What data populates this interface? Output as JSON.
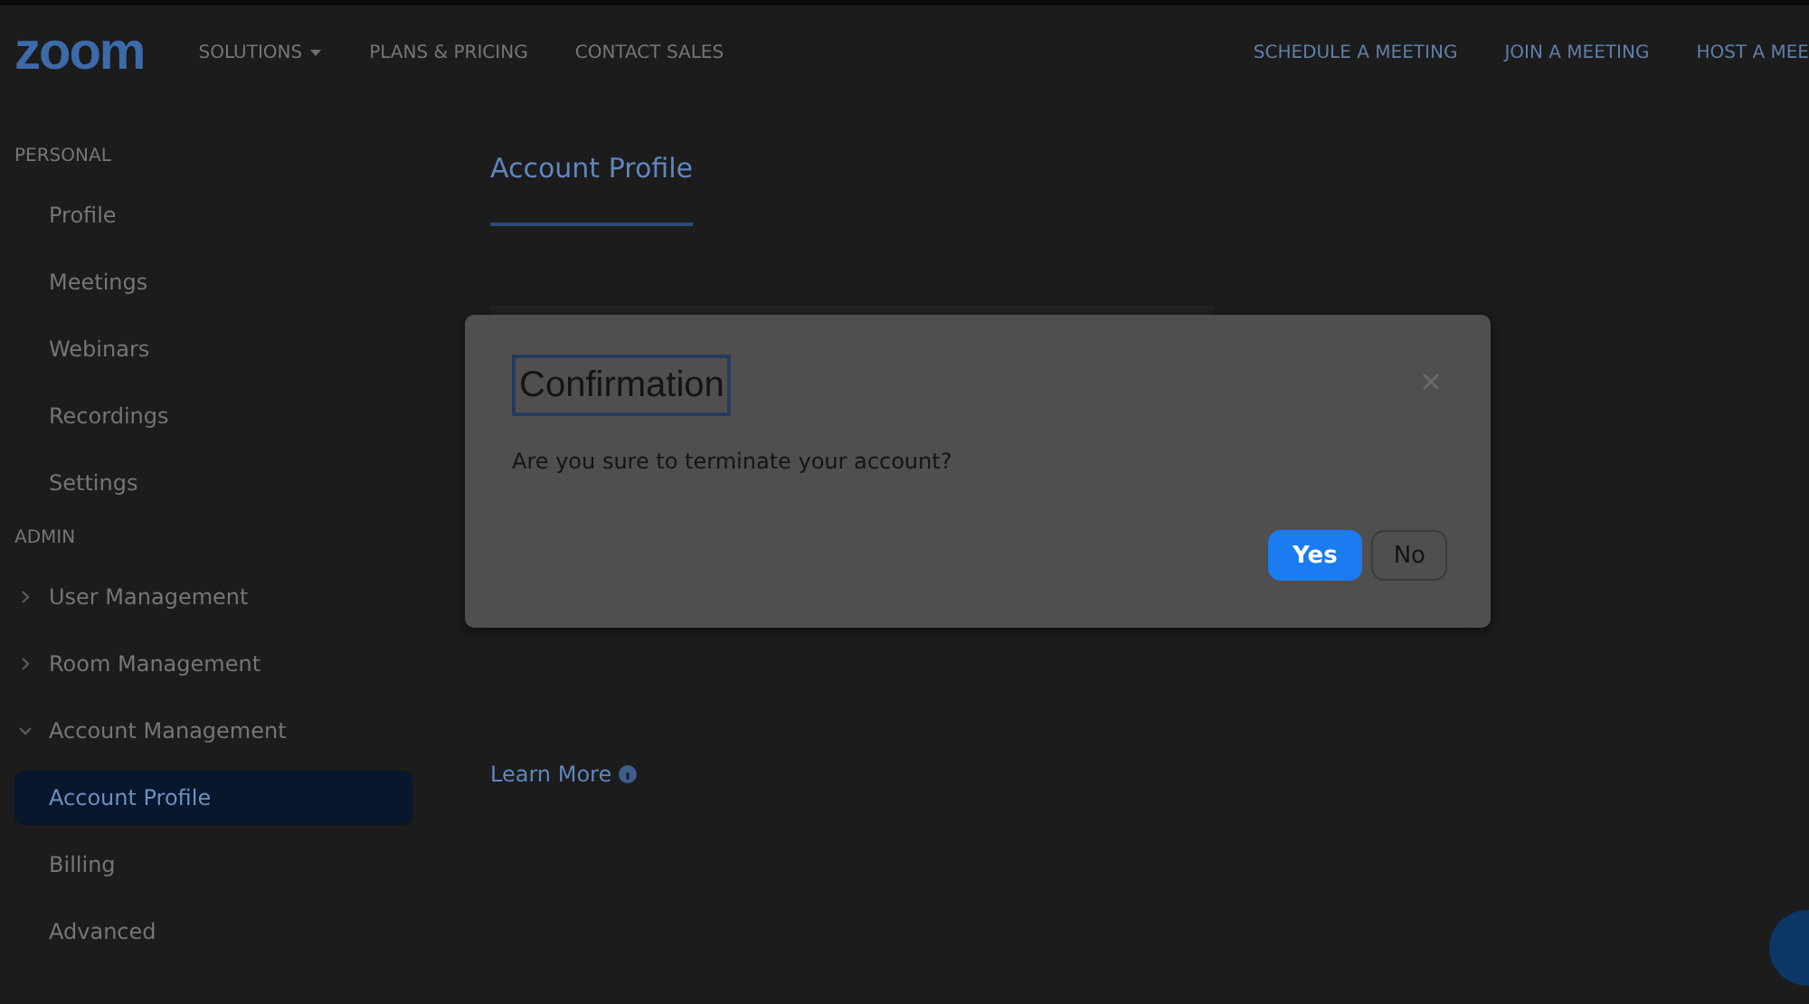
{
  "header": {
    "logo": "zoom",
    "nav_left": [
      {
        "label": "SOLUTIONS",
        "kind": "menu"
      },
      {
        "label": "PLANS & PRICING",
        "kind": "link"
      },
      {
        "label": "CONTACT SALES",
        "kind": "link"
      }
    ],
    "nav_right": [
      {
        "label": "SCHEDULE A MEETING"
      },
      {
        "label": "JOIN A MEETING"
      },
      {
        "label": "HOST A MEE"
      }
    ]
  },
  "sidebar": {
    "sections": [
      {
        "heading": "PERSONAL",
        "items": [
          {
            "label": "Profile",
            "selected": false
          },
          {
            "label": "Meetings",
            "selected": false
          },
          {
            "label": "Webinars",
            "selected": false
          },
          {
            "label": "Recordings",
            "selected": false
          },
          {
            "label": "Settings",
            "selected": false
          }
        ]
      },
      {
        "heading": "ADMIN",
        "items": [
          {
            "label": "User Management",
            "selected": false,
            "expanded": false
          },
          {
            "label": "Room Management",
            "selected": false,
            "expanded": false
          },
          {
            "label": "Account Management",
            "selected": false,
            "expanded": true,
            "children": [
              {
                "label": "Account Profile",
                "selected": true
              },
              {
                "label": "Billing",
                "selected": false
              },
              {
                "label": "Advanced",
                "selected": false
              }
            ]
          }
        ]
      }
    ]
  },
  "page": {
    "tabs": [
      {
        "label": "Account Profile",
        "selected": true
      }
    ],
    "link": "Learn More"
  },
  "dialog": {
    "title": "Confirmation",
    "message": "Are you sure to terminate your account?",
    "buttons": [
      {
        "label": "Yes",
        "kind": "primary"
      },
      {
        "label": "No",
        "kind": "secondary"
      }
    ]
  }
}
